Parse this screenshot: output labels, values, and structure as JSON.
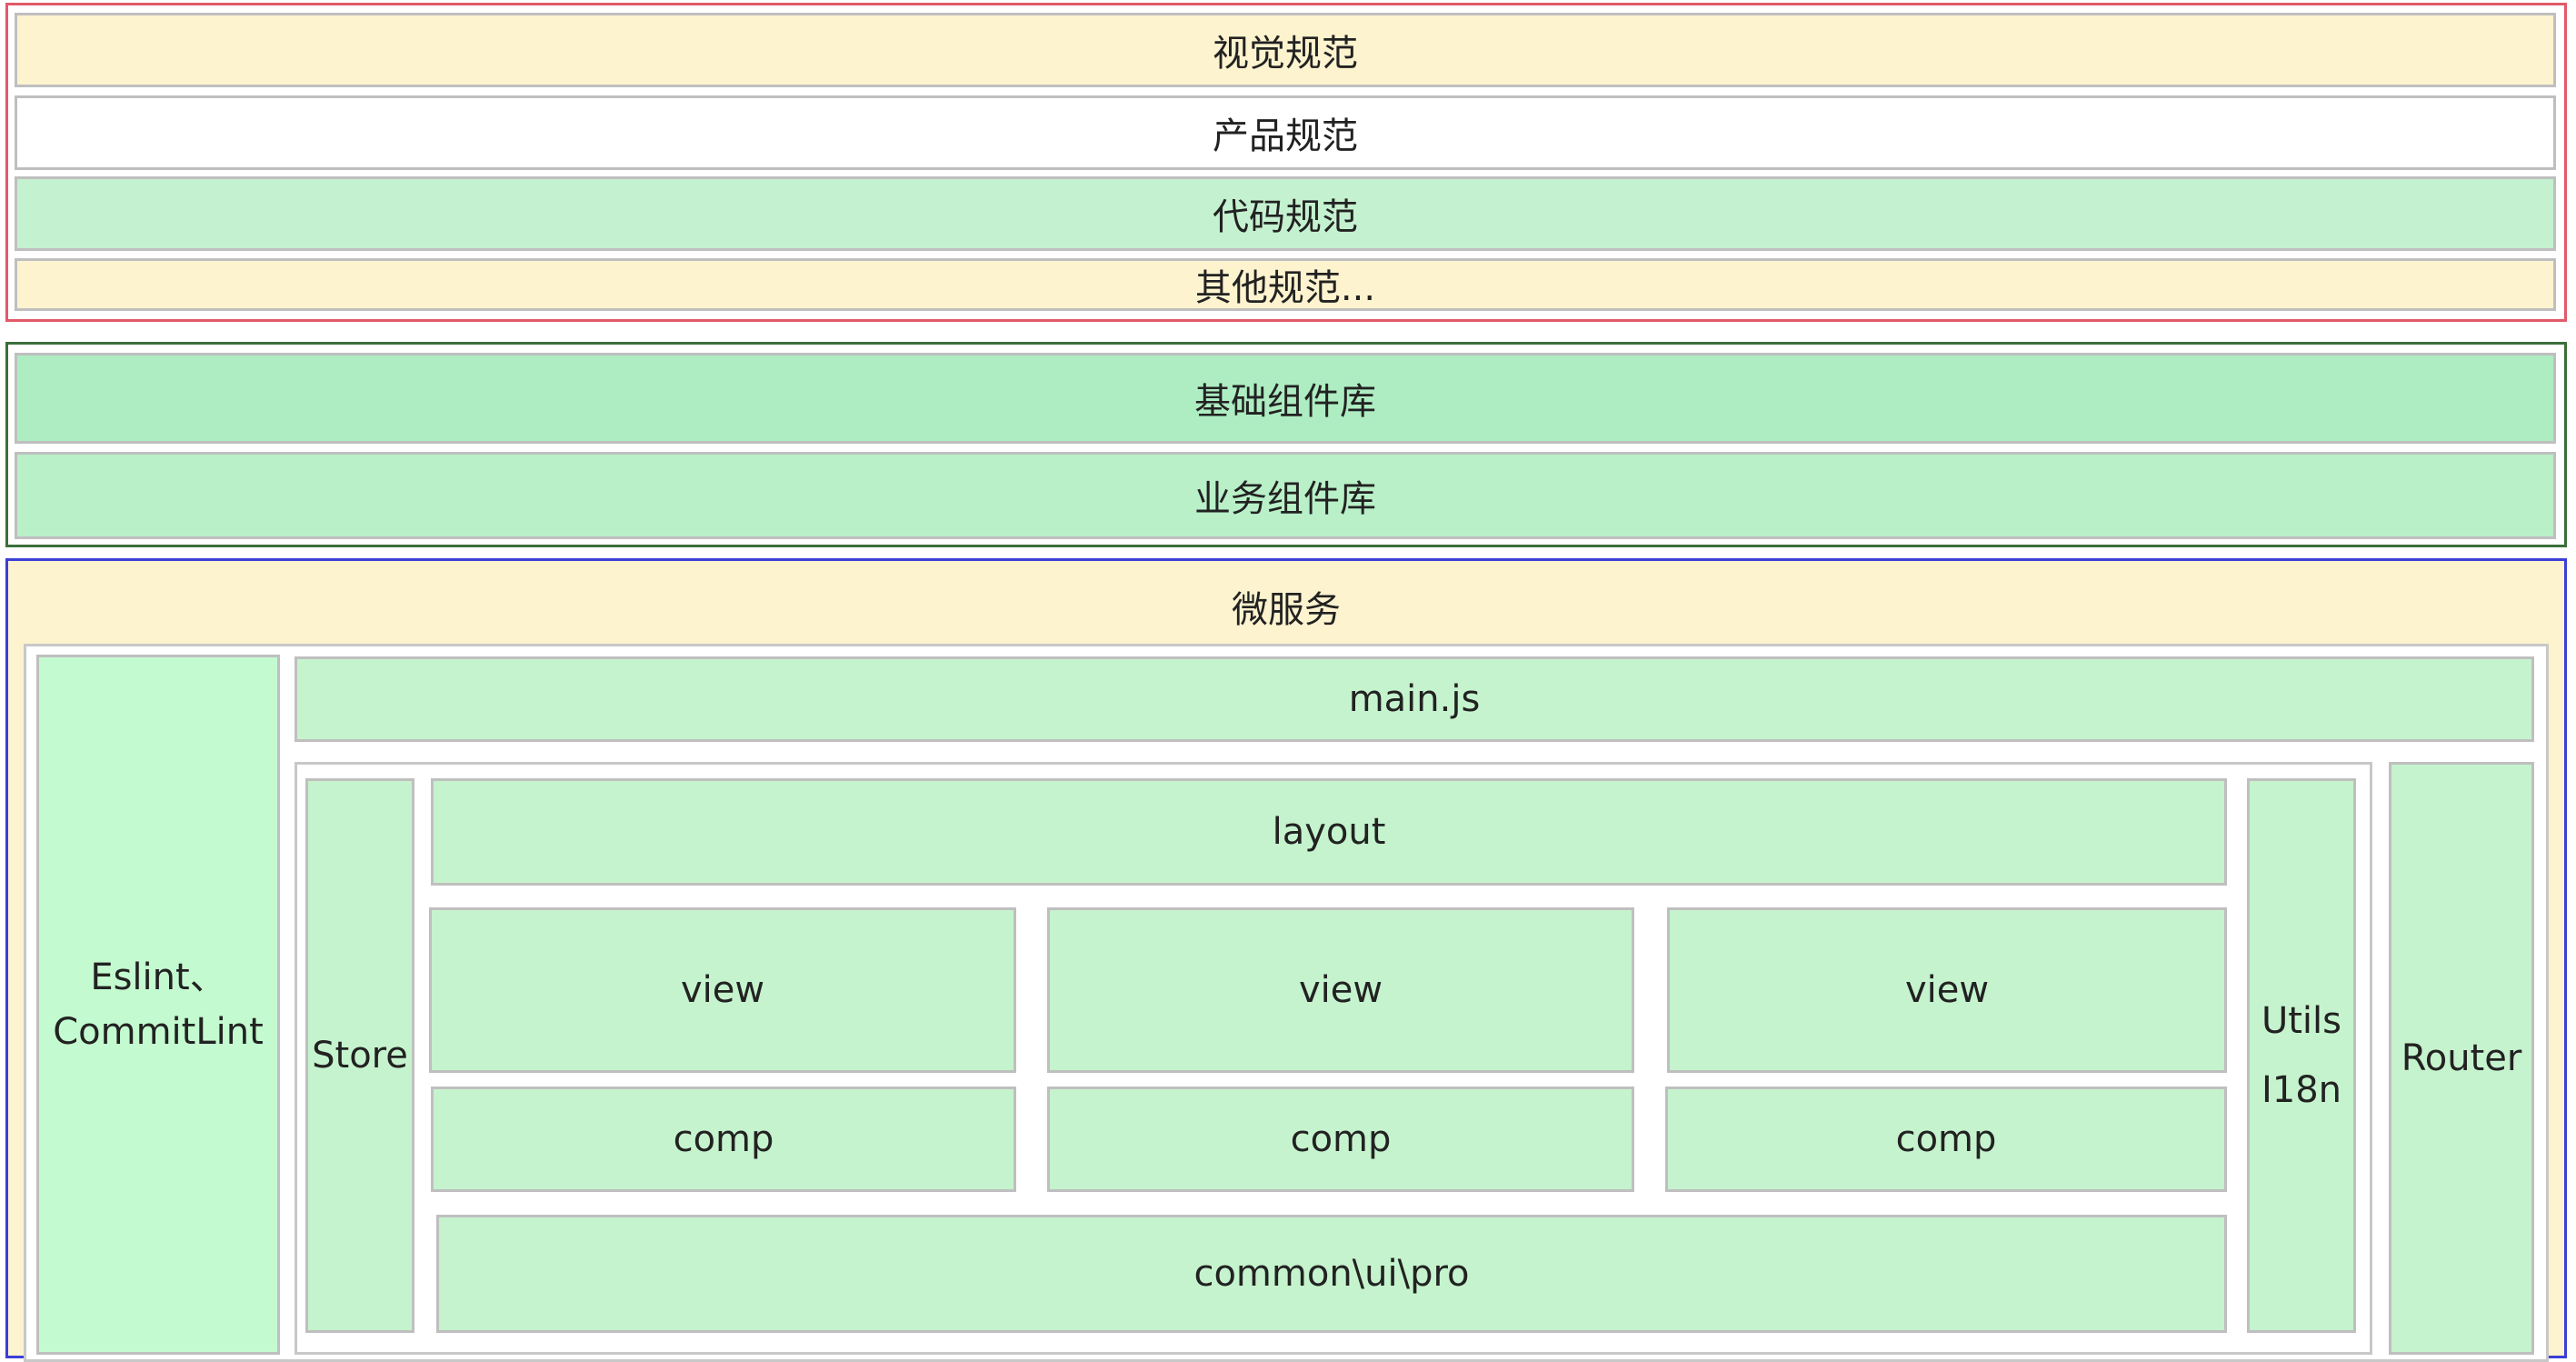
{
  "standards": {
    "visual": "视觉规范",
    "product": "产品规范",
    "code": "代码规范",
    "other": "其他规范..."
  },
  "component_libraries": {
    "base": "基础组件库",
    "business": "业务组件库"
  },
  "microservice": {
    "title": "微服务",
    "lint": [
      "Eslint、",
      "CommitLint"
    ],
    "main": "main.js",
    "store": "Store",
    "layout": "layout",
    "columns": [
      {
        "view": "view",
        "comp": "comp"
      },
      {
        "view": "view",
        "comp": "comp"
      },
      {
        "view": "view",
        "comp": "comp"
      }
    ],
    "common": "common\\ui\\pro",
    "utils": [
      "Utils",
      "I18n"
    ],
    "router": "Router"
  },
  "colors": {
    "standards_border": "#e15a6a",
    "libraries_border": "#3b6f3b",
    "microservice_border": "#3c3fd6",
    "yellow": "#fdf3cf",
    "green": "#c5f3cd"
  }
}
